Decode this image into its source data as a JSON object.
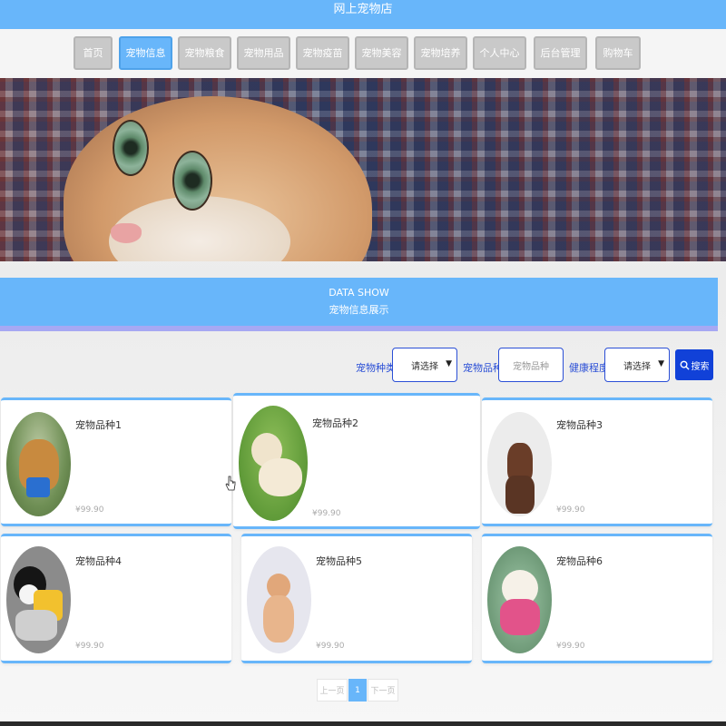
{
  "header": {
    "title": "网上宠物店"
  },
  "nav": {
    "items": [
      {
        "label": "首页"
      },
      {
        "label": "宠物信息"
      },
      {
        "label": "宠物粮食"
      },
      {
        "label": "宠物用品"
      },
      {
        "label": "宠物疫苗"
      },
      {
        "label": "宠物美容"
      },
      {
        "label": "宠物培养"
      },
      {
        "label": "个人中心"
      },
      {
        "label": "后台管理"
      },
      {
        "label": "购物车"
      }
    ],
    "active": "宠物信息"
  },
  "section": {
    "title_en": "DATA SHOW",
    "title_cn": "宠物信息展示"
  },
  "filters": {
    "type_label": "宠物种类",
    "type_value": "请选择",
    "breed_label": "宠物品种",
    "breed_placeholder": "宠物品种",
    "health_label": "健康程度",
    "health_value": "请选择",
    "search_label": "搜索"
  },
  "products": [
    {
      "name": "宠物品种1",
      "price": "¥99.90"
    },
    {
      "name": "宠物品种2",
      "price": "¥99.90"
    },
    {
      "name": "宠物品种3",
      "price": "¥99.90"
    },
    {
      "name": "宠物品种4",
      "price": "¥99.90"
    },
    {
      "name": "宠物品种5",
      "price": "¥99.90"
    },
    {
      "name": "宠物品种6",
      "price": "¥99.90"
    }
  ],
  "pagination": {
    "prev": "上一页",
    "current": "1",
    "next": "下一页"
  },
  "colors": {
    "primary": "#68b6fa",
    "search": "#1141d8",
    "filter_text": "#2b4fd6"
  }
}
